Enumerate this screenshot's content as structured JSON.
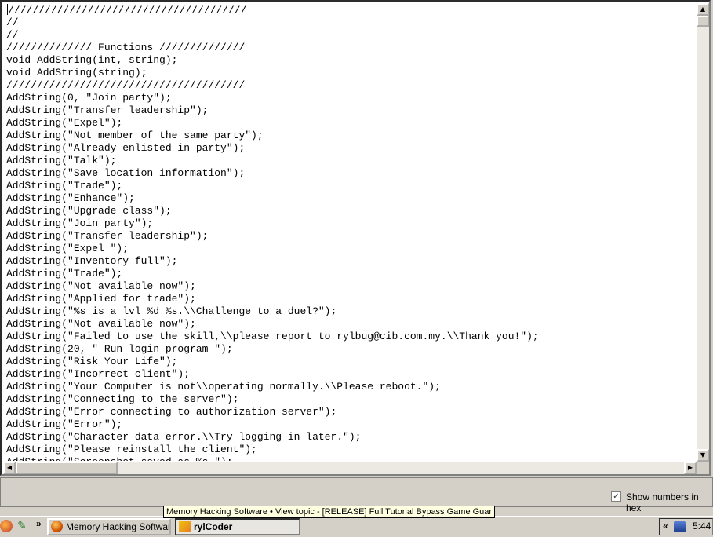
{
  "editor": {
    "lines": [
      "///////////////////////////////////////",
      "//",
      "//",
      "////////////// Functions //////////////",
      "void AddString(int, string);",
      "void AddString(string);",
      "///////////////////////////////////////",
      "AddString(0, \"Join party\");",
      "AddString(\"Transfer leadership\");",
      "AddString(\"Expel\");",
      "AddString(\"Not member of the same party\");",
      "AddString(\"Already enlisted in party\");",
      "AddString(\"Talk\");",
      "AddString(\"Save location information\");",
      "AddString(\"Trade\");",
      "AddString(\"Enhance\");",
      "AddString(\"Upgrade class\");",
      "AddString(\"Join party\");",
      "AddString(\"Transfer leadership\");",
      "AddString(\"Expel \");",
      "AddString(\"Inventory full\");",
      "AddString(\"Trade\");",
      "AddString(\"Not available now\");",
      "AddString(\"Applied for trade\");",
      "AddString(\"%s is a lvl %d %s.\\\\Challenge to a duel?\");",
      "AddString(\"Not available now\");",
      "AddString(\"Failed to use the skill,\\\\please report to rylbug@cib.com.my.\\\\Thank you!\");",
      "AddString(20, \" Run login program \");",
      "AddString(\"Risk Your Life\");",
      "AddString(\"Incorrect client\");",
      "AddString(\"Your Computer is not\\\\operating normally.\\\\Please reboot.\");",
      "AddString(\"Connecting to the server\");",
      "AddString(\"Error connecting to authorization server\");",
      "AddString(\"Error\");",
      "AddString(\"Character data error.\\\\Try logging in later.\");",
      "AddString(\"Please reinstall the client\");",
      "AddString(\"Screenshot saved as %s.\");"
    ]
  },
  "scrollbar": {
    "up_glyph": "▲",
    "down_glyph": "▼",
    "left_glyph": "◀",
    "right_glyph": "▶"
  },
  "panel": {
    "hex_checkbox_label": "Show numbers in hex",
    "hex_checked": true,
    "check_glyph": "✓"
  },
  "taskbar": {
    "tooltip": "Memory Hacking Software • View topic - [RELEASE] Full Tutorial Bypass Game Guar",
    "quicklaunch_chevron": "»",
    "tasks": [
      {
        "label": "Memory Hacking Softwar...",
        "icon": "firefox-icon",
        "active": false
      },
      {
        "label": "rylCoder",
        "icon": "rylcoder-icon",
        "active": true
      }
    ],
    "tray_chevron": "«",
    "clock": "5:44"
  }
}
